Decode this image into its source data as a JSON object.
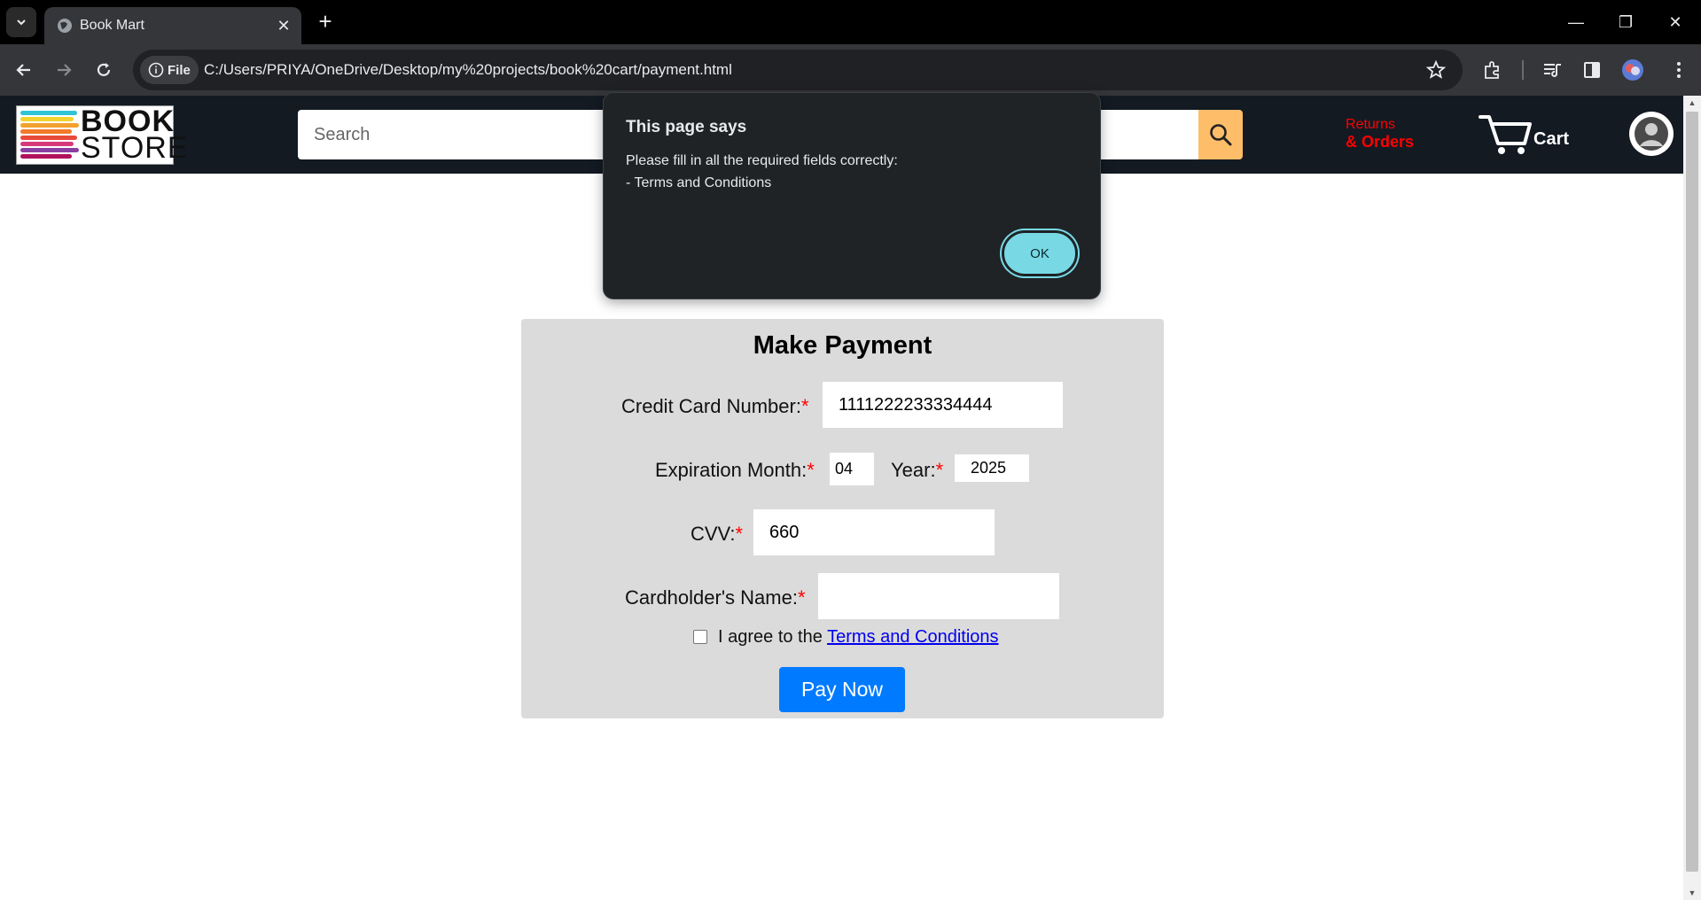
{
  "browser": {
    "tab_title": "Book Mart",
    "site_chip_label": "File",
    "url": "C:/Users/PRIYA/OneDrive/Desktop/my%20projects/book%20cart/payment.html"
  },
  "header": {
    "logo_line1": "BOOK",
    "logo_line2": "STORE",
    "search_placeholder": "Search",
    "returns_line1": "Returns",
    "returns_line2": "& Orders",
    "cart_label": "Cart"
  },
  "payment": {
    "title": "Make Payment",
    "required_mark": "*",
    "card_number_label": "Credit Card Number:",
    "card_number_value": "1111222233334444",
    "exp_month_label": "Expiration Month:",
    "exp_month_value": "04",
    "year_label": "Year:",
    "year_value": "2025",
    "cvv_label": "CVV:",
    "cvv_value": "660",
    "name_label": "Cardholder's Name:",
    "name_value": "",
    "agree_prefix": "I agree to the",
    "terms_link": "Terms and Conditions",
    "pay_button": "Pay Now"
  },
  "dialog": {
    "title": "This page says",
    "message_line1": "Please fill in all the required fields correctly:",
    "message_line2": "- Terms and Conditions",
    "ok_label": "OK"
  },
  "colors": {
    "header_bg": "#131a22",
    "search_button": "#febd69",
    "returns_text": "#ff0000",
    "pay_button": "#007bff",
    "dialog_ok": "#78d9e5"
  }
}
